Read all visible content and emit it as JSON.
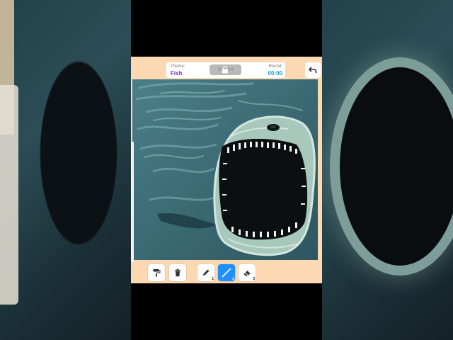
{
  "header": {
    "theme_label": "Theme:",
    "theme_value": "Fish",
    "submit_label": "Submit",
    "round_label": "Round:",
    "round_value": "00:00"
  },
  "toolbar": {
    "tools": [
      {
        "name": "paint-roller",
        "number": ""
      },
      {
        "name": "trash",
        "number": ""
      },
      {
        "name": "pencil",
        "number": "1"
      },
      {
        "name": "line",
        "number": "2",
        "active": true
      },
      {
        "name": "eraser",
        "number": "3"
      }
    ]
  },
  "colors": {
    "accent": "#1e90ff",
    "theme_text": "#8a2be2",
    "timer_text": "#1a9bd7",
    "frame_bg": "#fcd9b3"
  },
  "canvas": {
    "drawing_subject": "giant fish with open mouth in dark water"
  }
}
